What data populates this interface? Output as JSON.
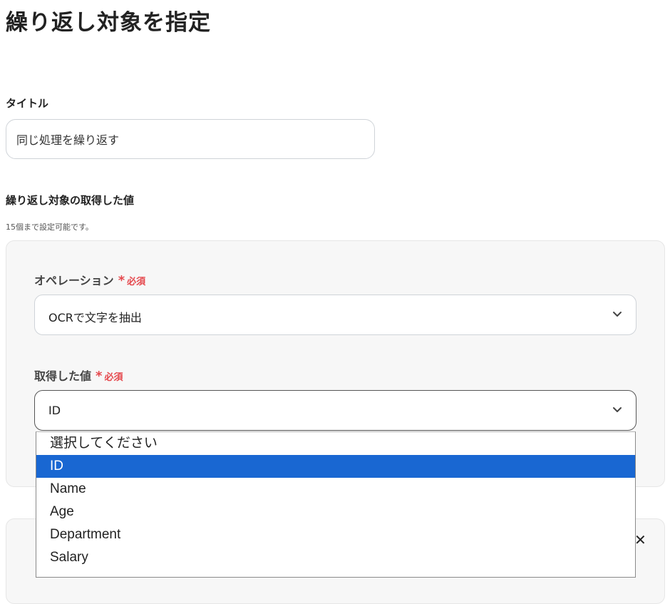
{
  "page": {
    "title": "繰り返し対象を指定"
  },
  "title_field": {
    "label": "タイトル",
    "value": "同じ処理を繰り返す"
  },
  "target": {
    "label": "繰り返し対象の取得した値",
    "hint": "15個まで設定可能です。"
  },
  "operation": {
    "label": "オペレーション",
    "required_star": "*",
    "required_text": "必須",
    "value": "OCRで文字を抽出"
  },
  "value_field": {
    "label": "取得した値",
    "required_star": "*",
    "required_text": "必須",
    "value": "ID"
  },
  "dropdown": {
    "options": [
      {
        "label": "選択してください"
      },
      {
        "label": "ID",
        "selected": true
      },
      {
        "label": "Name"
      },
      {
        "label": "Age"
      },
      {
        "label": "Department"
      },
      {
        "label": "Salary"
      }
    ]
  },
  "icons": {
    "close": "close-icon",
    "chevron": "chevron-down-icon"
  },
  "colors": {
    "accent": "#1967d2",
    "required": "#e5484d"
  }
}
